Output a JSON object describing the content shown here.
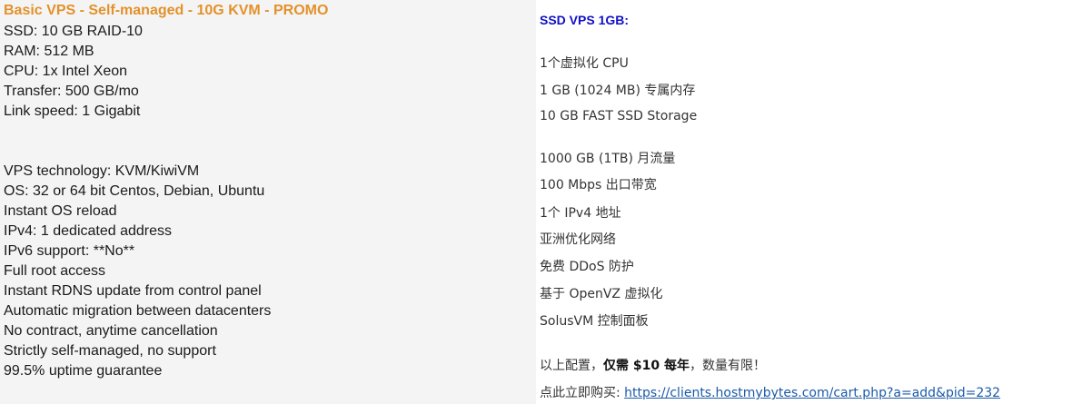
{
  "left": {
    "title": "Basic VPS - Self-managed - 10G KVM - PROMO",
    "specs": [
      "SSD: 10 GB RAID-10",
      "RAM: 512 MB",
      "CPU: 1x Intel Xeon",
      "Transfer: 500 GB/mo",
      "Link speed: 1 Gigabit"
    ],
    "features": [
      "VPS technology: KVM/KiwiVM",
      "OS: 32 or 64 bit Centos, Debian, Ubuntu",
      "Instant OS reload",
      "IPv4: 1 dedicated address",
      "IPv6 support: **No**",
      "Full root access",
      "Instant RDNS update from control panel",
      "Automatic migration between datacenters",
      "No contract, anytime cancellation",
      "Strictly self-managed, no support",
      "99.5% uptime guarantee"
    ]
  },
  "right": {
    "title": "SSD VPS 1GB:",
    "specs": [
      "1个虚拟化 CPU",
      "1 GB (1024 MB) 专属内存",
      "10 GB FAST SSD Storage"
    ],
    "features": [
      "1000 GB (1TB) 月流量",
      "100 Mbps 出口带宽",
      "1个 IPv4 地址",
      "亚洲优化网络",
      "免费 DDoS 防护",
      "基于 OpenVZ 虚拟化",
      "SolusVM 控制面板"
    ],
    "promo_prefix": "以上配置，",
    "promo_bold": "仅需 $10 每年",
    "promo_suffix": "，数量有限！",
    "buy_label": "点此立即购买: ",
    "buy_link": "https://clients.hostmybytes.com/cart.php?a=add&pid=232"
  }
}
